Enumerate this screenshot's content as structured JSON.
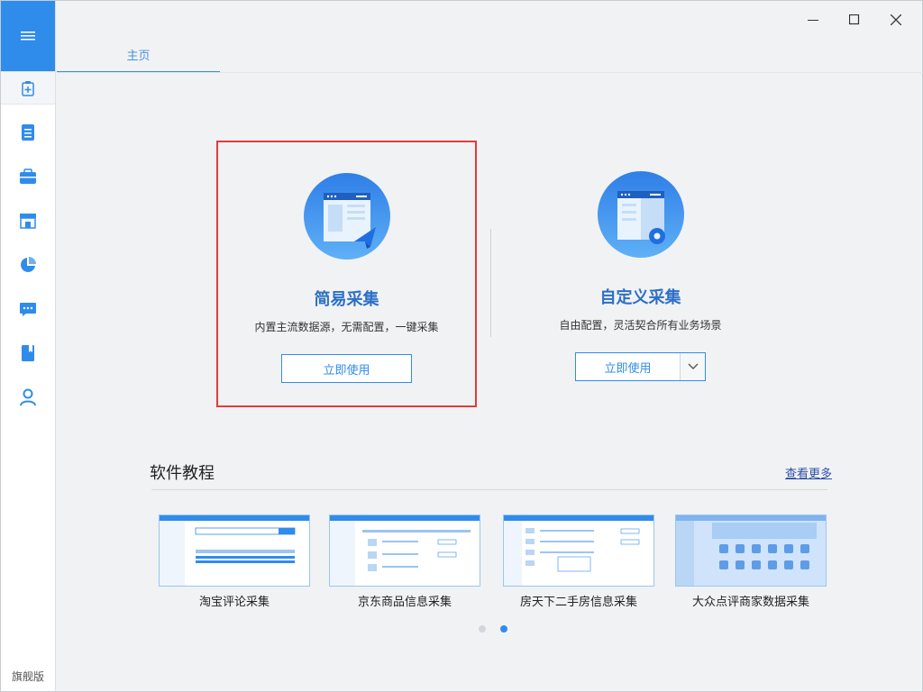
{
  "sidebar": {
    "menu_icon": "hamburger-icon",
    "items": [
      {
        "name": "new-task",
        "icon": "clipboard-plus-icon"
      },
      {
        "name": "tasks",
        "icon": "document-list-icon"
      },
      {
        "name": "toolbox",
        "icon": "briefcase-icon"
      },
      {
        "name": "store",
        "icon": "storefront-icon"
      },
      {
        "name": "stats",
        "icon": "pie-chart-icon"
      },
      {
        "name": "messages",
        "icon": "chat-icon"
      },
      {
        "name": "tutorial",
        "icon": "book-icon"
      },
      {
        "name": "account",
        "icon": "user-icon"
      }
    ],
    "edition": "旗舰版"
  },
  "tabs": [
    {
      "label": "主页"
    }
  ],
  "cards": {
    "simple": {
      "title": "简易采集",
      "desc": "内置主流数据源，无需配置，一键采集",
      "button": "立即使用"
    },
    "custom": {
      "title": "自定义采集",
      "desc": "自由配置，灵活契合所有业务场景",
      "button": "立即使用"
    }
  },
  "tutorials": {
    "title": "软件教程",
    "more": "查看更多",
    "items": [
      {
        "label": "淘宝评论采集"
      },
      {
        "label": "京东商品信息采集"
      },
      {
        "label": "房天下二手房信息采集"
      },
      {
        "label": "大众点评商家数据采集"
      }
    ]
  },
  "pagination": {
    "pages": 2,
    "active": 2
  },
  "colors": {
    "accent": "#2f8ceb",
    "highlight": "#e23b3b",
    "title": "#2c6fc7"
  }
}
